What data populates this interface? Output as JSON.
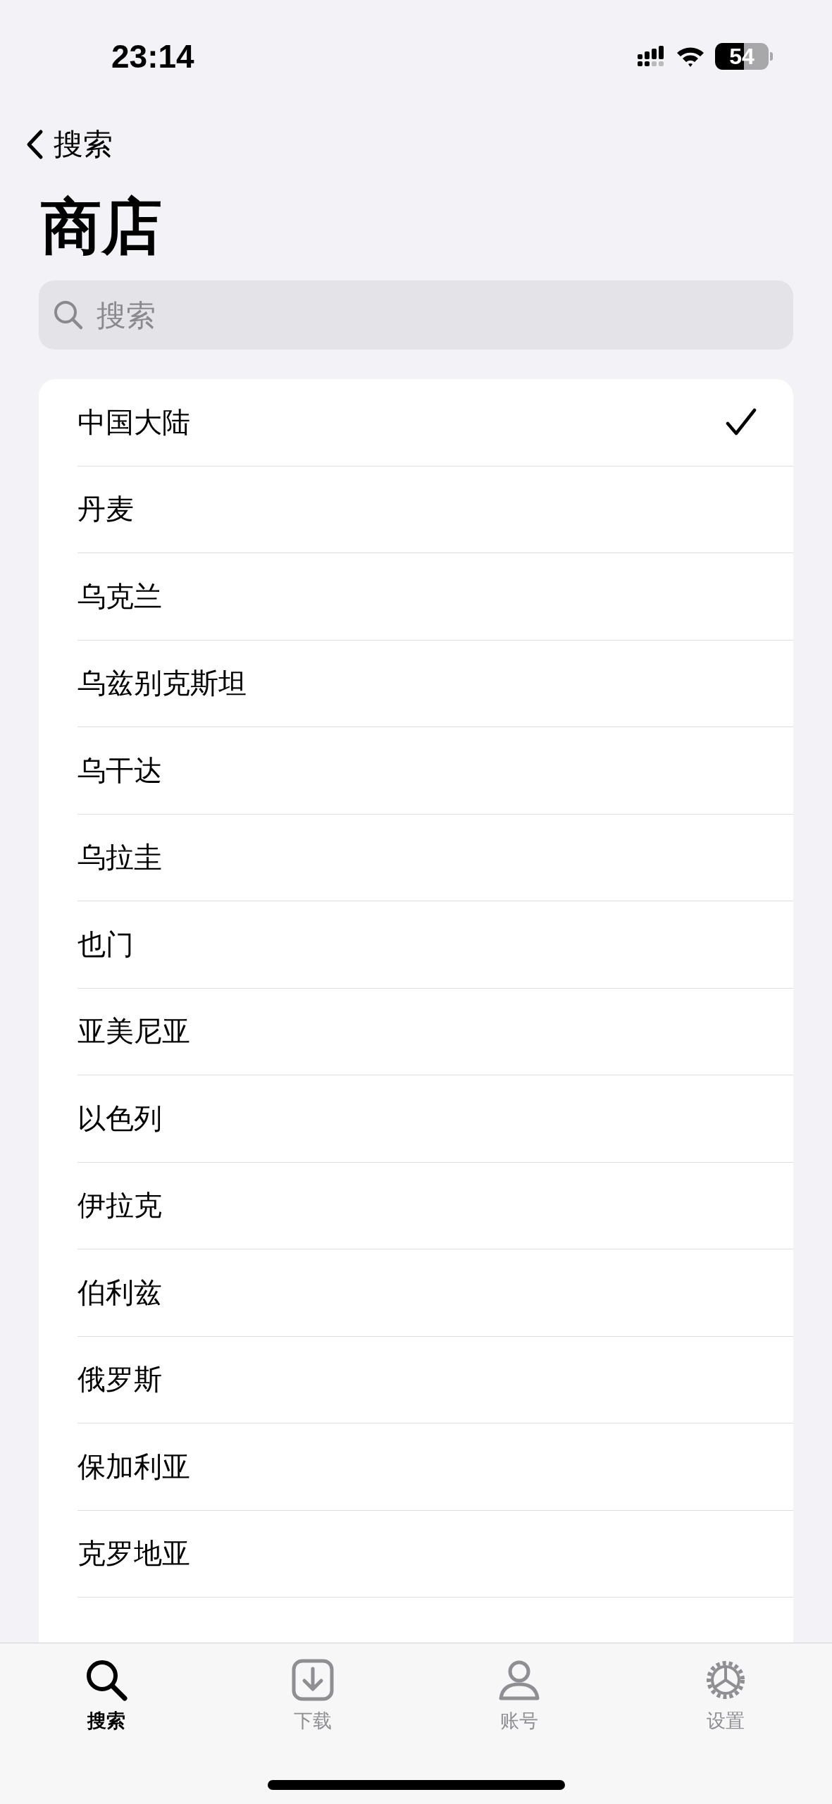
{
  "status_bar": {
    "time": "23:14",
    "battery": {
      "reading": "54",
      "level": 0.54
    }
  },
  "nav": {
    "back_label": "搜索"
  },
  "title": "商店",
  "search": {
    "placeholder": "搜索"
  },
  "stores": [
    {
      "name": "中国大陆",
      "selected": true
    },
    {
      "name": "丹麦",
      "selected": false
    },
    {
      "name": "乌克兰",
      "selected": false
    },
    {
      "name": "乌兹别克斯坦",
      "selected": false
    },
    {
      "name": "乌干达",
      "selected": false
    },
    {
      "name": "乌拉圭",
      "selected": false
    },
    {
      "name": "也门",
      "selected": false
    },
    {
      "name": "亚美尼亚",
      "selected": false
    },
    {
      "name": "以色列",
      "selected": false
    },
    {
      "name": "伊拉克",
      "selected": false
    },
    {
      "name": "伯利兹",
      "selected": false
    },
    {
      "name": "俄罗斯",
      "selected": false
    },
    {
      "name": "保加利亚",
      "selected": false
    },
    {
      "name": "克罗地亚",
      "selected": false
    }
  ],
  "tab_bar": [
    {
      "label": "搜索",
      "kind": "search",
      "selected": true
    },
    {
      "label": "下载",
      "kind": "download",
      "selected": false
    },
    {
      "label": "账号",
      "kind": "account",
      "selected": false
    },
    {
      "label": "设置",
      "kind": "settings",
      "selected": false
    }
  ]
}
